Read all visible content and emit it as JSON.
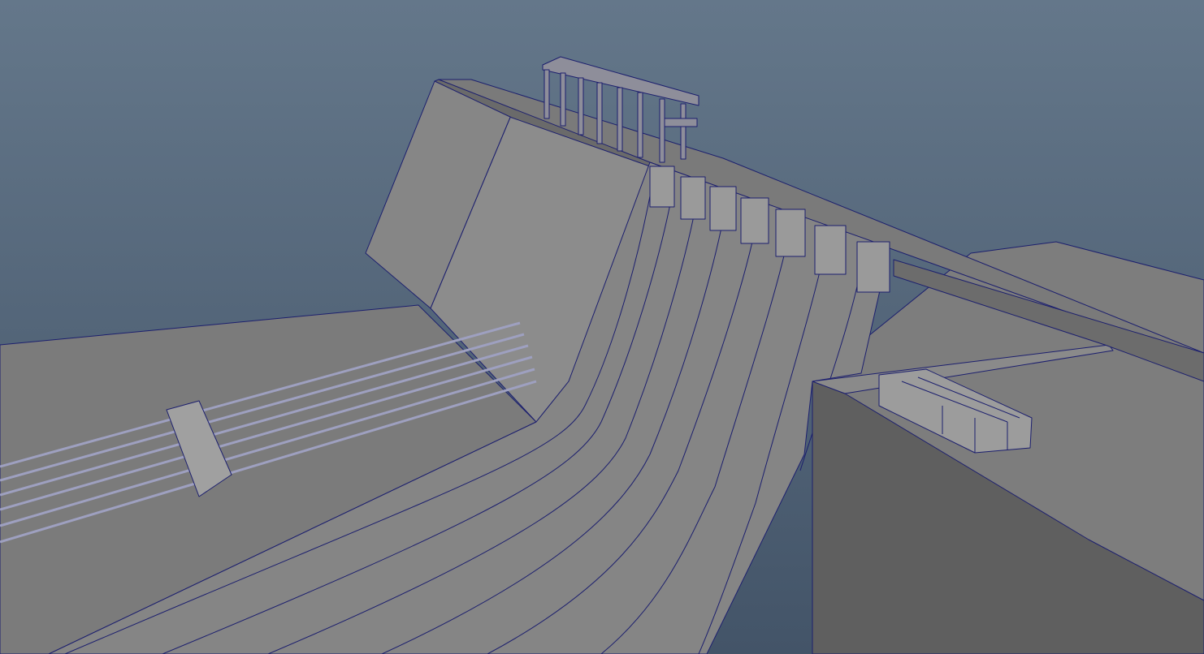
{
  "viewport": {
    "description_label": "",
    "colors": {
      "sky_top": "#64778a",
      "sky_bottom": "#435468",
      "ground": "#7b7b7b",
      "surface_light": "#8c8c8c",
      "surface_dark": "#5e5e5e",
      "wireframe": "#1c1f6e"
    }
  }
}
